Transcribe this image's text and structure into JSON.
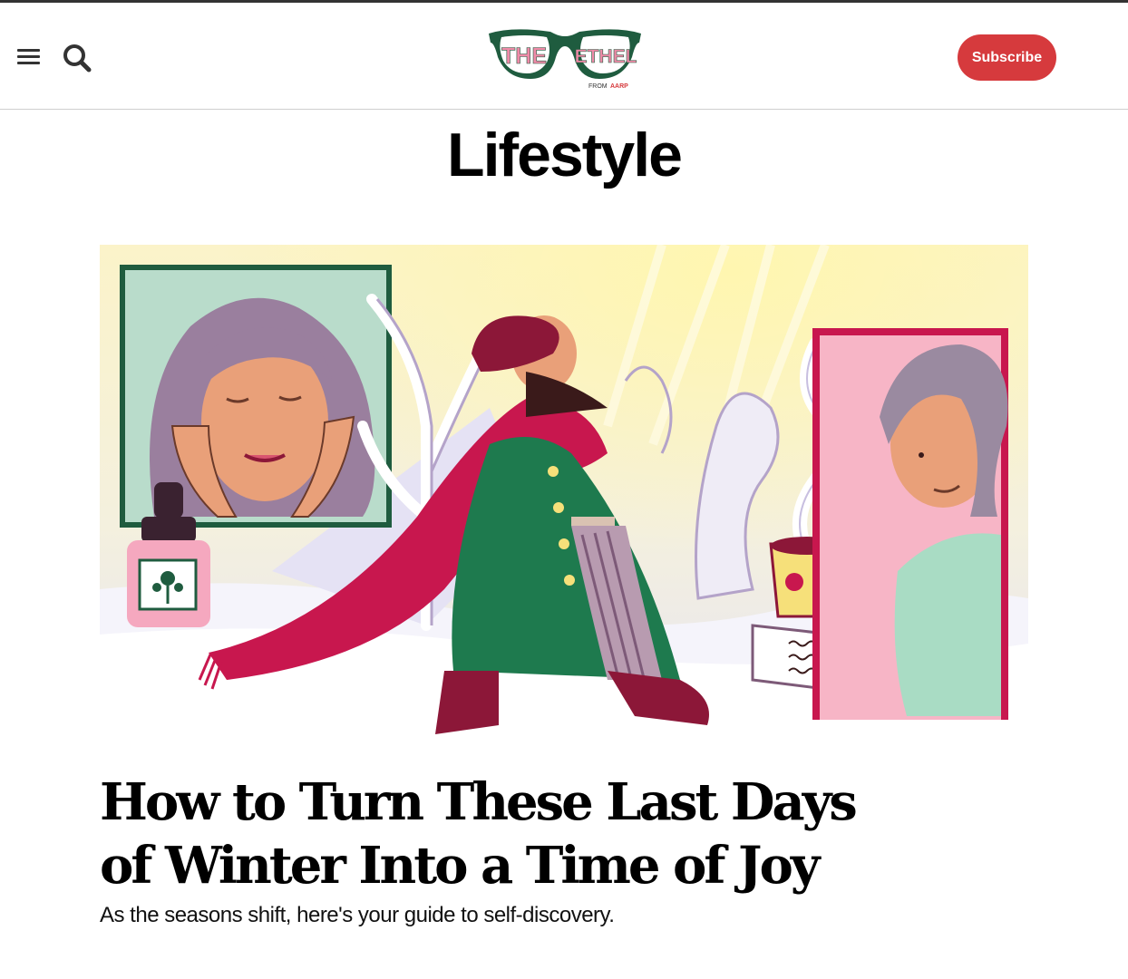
{
  "header": {
    "logo": {
      "word1": "THE",
      "word2": "ETHEL",
      "tagline_prefix": "FROM",
      "tagline_brand": "AARP"
    },
    "subscribe_label": "Subscribe",
    "menu_icon": "hamburger-icon",
    "search_icon": "search-icon"
  },
  "section": {
    "title": "Lifestyle"
  },
  "article": {
    "headline": "How to Turn These Last Days of Winter Into a Time of Joy",
    "dek": "As the seasons shift, here's your guide to self-discovery."
  },
  "colors": {
    "subscribe": "#d63a3d",
    "logo_green": "#1f5c3f",
    "logo_pink": "#f08aa8",
    "scarf": "#c8174e",
    "coat": "#1e7a4e",
    "beret": "#8c1738"
  }
}
